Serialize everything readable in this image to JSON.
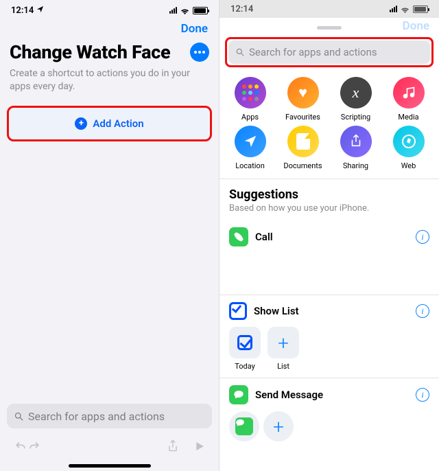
{
  "left": {
    "status": {
      "time": "12:14",
      "loc_icon": "location-arrow"
    },
    "nav": {
      "done": "Done"
    },
    "title": "Change Watch Face",
    "subtitle": "Create a shortcut to actions you do in your apps every day.",
    "add_action": {
      "label": "Add Action"
    },
    "search": {
      "placeholder": "Search for apps and actions"
    }
  },
  "right": {
    "status": {
      "time": "12:14"
    },
    "nav": {
      "done": "Done"
    },
    "search": {
      "placeholder": "Search for apps and actions"
    },
    "categories": [
      {
        "key": "apps",
        "label": "Apps"
      },
      {
        "key": "favourites",
        "label": "Favourites"
      },
      {
        "key": "scripting",
        "label": "Scripting"
      },
      {
        "key": "media",
        "label": "Media"
      },
      {
        "key": "location",
        "label": "Location"
      },
      {
        "key": "documents",
        "label": "Documents"
      },
      {
        "key": "sharing",
        "label": "Sharing"
      },
      {
        "key": "web",
        "label": "Web"
      }
    ],
    "suggestions": {
      "heading": "Suggestions",
      "subheading": "Based on how you use your iPhone.",
      "items": [
        {
          "title": "Call",
          "icon": "phone"
        },
        {
          "title": "Show List",
          "icon": "checkbox",
          "options": [
            {
              "label": "Today",
              "kind": "check"
            },
            {
              "label": "List",
              "kind": "plus"
            }
          ]
        },
        {
          "title": "Send Message",
          "icon": "message"
        }
      ]
    }
  }
}
